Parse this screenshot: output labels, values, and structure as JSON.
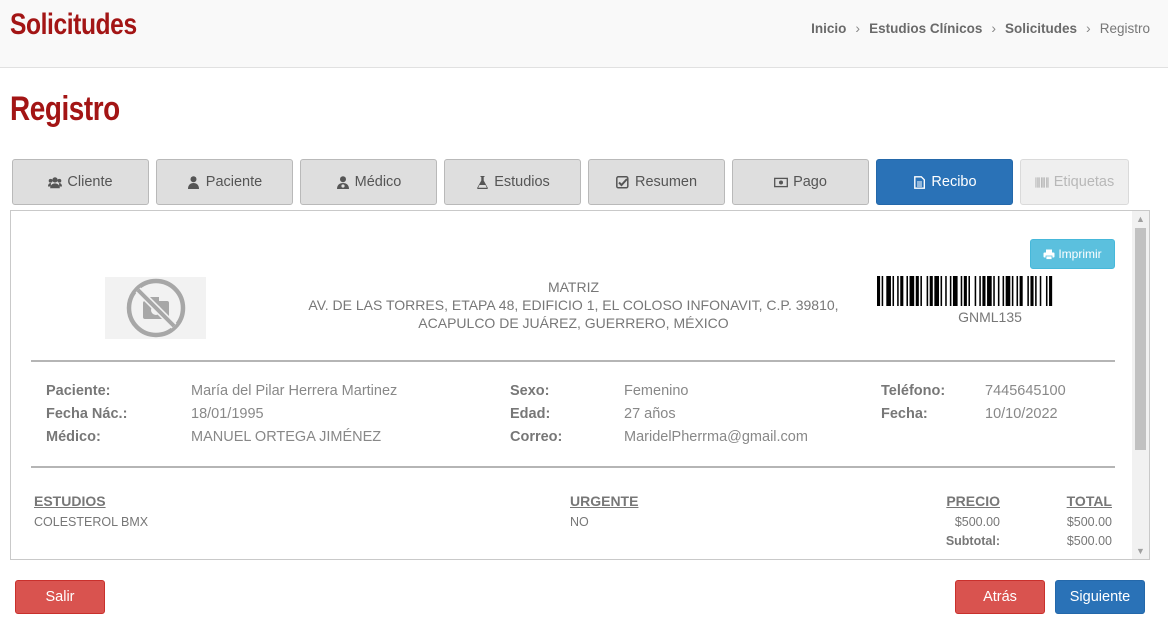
{
  "header": {
    "title": "Solicitudes",
    "breadcrumb": [
      {
        "label": "Inicio"
      },
      {
        "label": "Estudios Clínicos"
      },
      {
        "label": "Solicitudes"
      },
      {
        "label": "Registro"
      }
    ],
    "separator": "›"
  },
  "page_title": "Registro",
  "tabs": [
    {
      "label": "Cliente",
      "icon": "users-icon",
      "state": "normal"
    },
    {
      "label": "Paciente",
      "icon": "user-icon",
      "state": "normal"
    },
    {
      "label": "Médico",
      "icon": "user-md-icon",
      "state": "normal"
    },
    {
      "label": "Estudios",
      "icon": "flask-icon",
      "state": "normal"
    },
    {
      "label": "Resumen",
      "icon": "check-square-icon",
      "state": "normal"
    },
    {
      "label": "Pago",
      "icon": "money-icon",
      "state": "normal"
    },
    {
      "label": "Recibo",
      "icon": "file-text-icon",
      "state": "active"
    },
    {
      "label": "Etiquetas",
      "icon": "barcode-icon",
      "state": "disabled"
    }
  ],
  "receipt": {
    "print_label": "Imprimir",
    "branch": "MATRIZ",
    "address_line1": "AV. DE LAS TORRES, ETAPA 48, EDIFICIO 1, EL COLOSO INFONAVIT, C.P. 39810,",
    "address_line2": "ACAPULCO DE JUÁREZ, GUERRERO, MÉXICO",
    "barcode_text": "GNML135",
    "patient": {
      "paciente_label": "Paciente:",
      "paciente": "María del Pilar Herrera Martinez",
      "fecha_nac_label": "Fecha Nác.:",
      "fecha_nac": "18/01/1995",
      "medico_label": "Médico:",
      "medico": "MANUEL ORTEGA JIMÉNEZ",
      "sexo_label": "Sexo:",
      "sexo": "Femenino",
      "edad_label": "Edad:",
      "edad": "27 años",
      "correo_label": "Correo:",
      "correo": "MaridelPherrma@gmail.com",
      "telefono_label": "Teléfono:",
      "telefono": "7445645100",
      "fecha_label": "Fecha:",
      "fecha": "10/10/2022"
    },
    "studies": {
      "headers": {
        "estudios": "ESTUDIOS",
        "urgente": "URGENTE",
        "precio": "PRECIO",
        "total": "TOTAL"
      },
      "rows": [
        {
          "estudio": "COLESTEROL BMX",
          "urgente": "NO",
          "precio": "$500.00",
          "total": "$500.00"
        }
      ],
      "subtotal_label": "Subtotal:",
      "subtotal": "$500.00"
    }
  },
  "footer": {
    "salir": "Salir",
    "atras": "Atrás",
    "siguiente": "Siguiente"
  },
  "colors": {
    "brand_red": "#a31515",
    "primary_blue": "#2a72b7",
    "danger_red": "#d9534f",
    "info_cyan": "#5bc0de"
  }
}
